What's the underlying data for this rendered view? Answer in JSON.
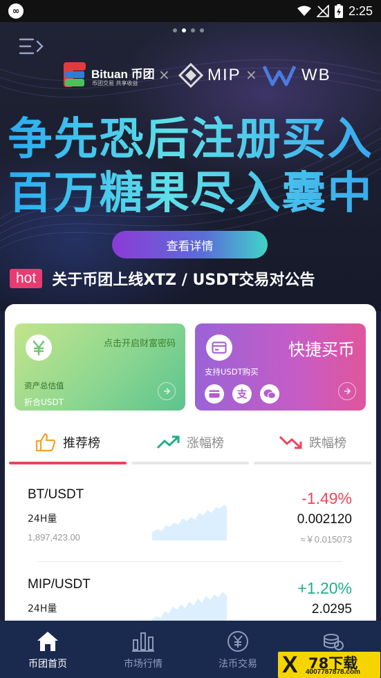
{
  "status_bar": {
    "time": "2:25",
    "icons": [
      "app-icon",
      "wifi-icon",
      "signal-off-icon",
      "battery-charging-icon"
    ]
  },
  "banner": {
    "carousel_dots": 4,
    "active_dot": 1,
    "partners": {
      "bituan_name": "Bituan 币团",
      "bituan_tagline": "币团交易 共享收益",
      "mip": "MIP",
      "wb": "WB",
      "separator": "×"
    },
    "headline_line1": "争先恐后注册买入",
    "headline_line2": "百万糖果尽入囊中",
    "cta_label": "查看详情",
    "notice_badge": "hot",
    "notice_text": "关于币团上线XTZ / USDT交易对公告"
  },
  "cards": {
    "assets": {
      "link": "点击开启财富密码",
      "label": "资产总估值",
      "sub": "折合USDT",
      "icon": "yen-icon"
    },
    "quick_buy": {
      "title": "快捷买币",
      "sub": "支持USDT购买",
      "icon": "card-icon",
      "pay_methods": [
        "bank-card-icon",
        "alipay-icon",
        "wechat-icon"
      ]
    }
  },
  "tabs": [
    {
      "label": "推荐榜",
      "icon": "thumbs-up-icon",
      "active": true
    },
    {
      "label": "涨幅榜",
      "icon": "trend-up-icon",
      "active": false
    },
    {
      "label": "跌幅榜",
      "icon": "trend-down-icon",
      "active": false
    }
  ],
  "market": [
    {
      "pair": "BT/USDT",
      "volume_label": "24H量",
      "volume": "1,897,423.00",
      "change": "-1.49%",
      "price": "0.002120",
      "cny": "≈￥0.015073",
      "direction": "down"
    },
    {
      "pair": "MIP/USDT",
      "volume_label": "24H量",
      "volume": "",
      "change": "+1.20%",
      "price": "2.0295",
      "cny": "",
      "direction": "up"
    }
  ],
  "bottom_nav": [
    {
      "label": "币团首页",
      "icon": "home-icon",
      "active": true
    },
    {
      "label": "市场行情",
      "icon": "bar-chart-icon",
      "active": false
    },
    {
      "label": "法币交易",
      "icon": "yen-circle-icon",
      "active": false
    },
    {
      "label": "",
      "icon": "coins-icon",
      "active": false
    }
  ],
  "watermark": {
    "text": "78下载",
    "sub": "4007787878.com"
  },
  "colors": {
    "accent_red": "#e8465c",
    "accent_green": "#1fae8a",
    "nav_bg": "#1a2a4f",
    "hot_badge": "#e83b72"
  }
}
